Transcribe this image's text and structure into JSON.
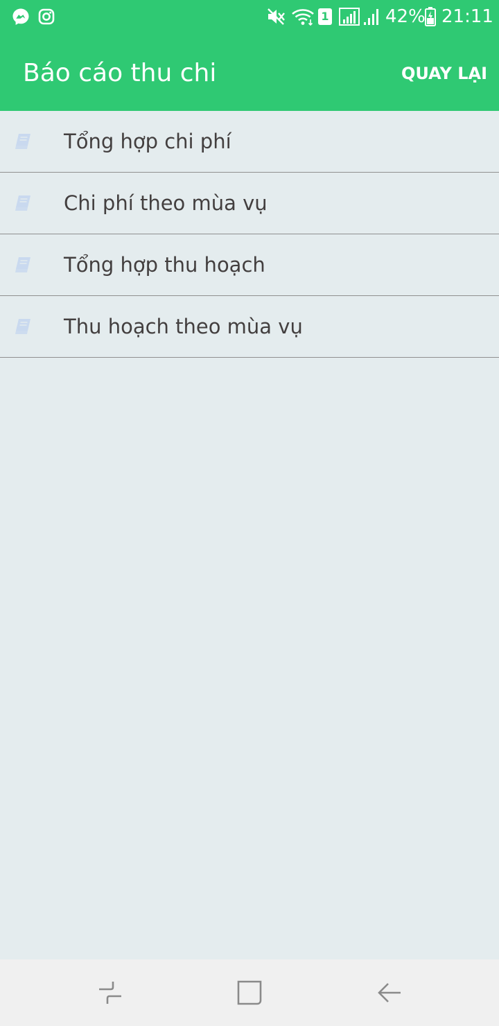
{
  "status_bar": {
    "battery_percent": "42%",
    "time": "21:11",
    "sim_slot": "1"
  },
  "header": {
    "title": "Báo cáo thu chi",
    "back_label": "QUAY LẠI"
  },
  "report_items": [
    {
      "label": "Tổng hợp chi phí",
      "icon": "book-icon"
    },
    {
      "label": "Chi phí theo mùa vụ",
      "icon": "book-icon"
    },
    {
      "label": "Tổng hợp thu hoạch",
      "icon": "book-icon"
    },
    {
      "label": "Thu hoạch theo mùa vụ",
      "icon": "book-icon"
    }
  ],
  "navigation": {
    "buttons": [
      "recent-apps-icon",
      "home-icon",
      "back-arrow-icon"
    ]
  },
  "colors": {
    "header_bg": "#2fc973",
    "page_bg": "#e4ecee",
    "item_text": "#433f3f",
    "divider": "#8f8f8f",
    "icon_tint": "#c9d9ef",
    "nav_bg": "#f0f0f0",
    "nav_icon": "#8a8a8a"
  }
}
